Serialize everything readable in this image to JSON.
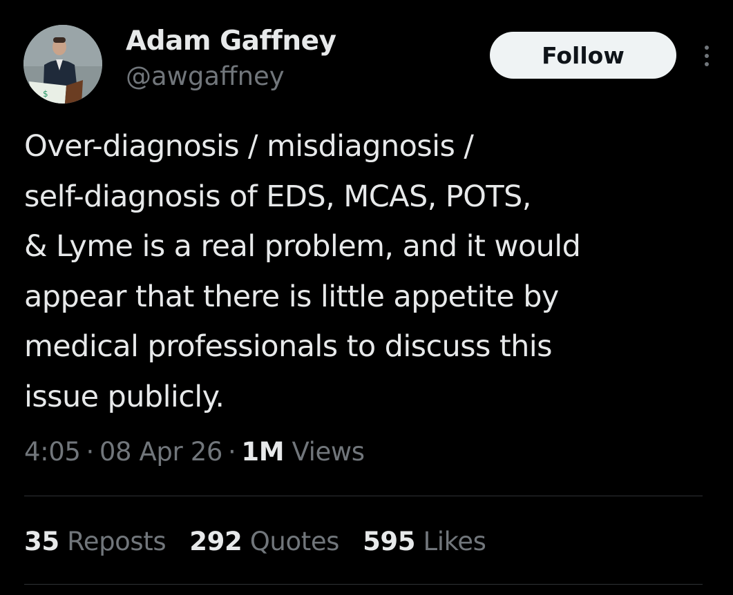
{
  "author": {
    "display_name": "Adam Gaffney",
    "handle": "@awgaffney"
  },
  "actions": {
    "follow_label": "Follow"
  },
  "tweet": {
    "text_lines": [
      "Over-diagnosis / misdiagnosis /",
      "self-diagnosis of EDS, MCAS, POTS,",
      "& Lyme is a real problem, and it would",
      "appear that there is little appetite by",
      "medical professionals to discuss this",
      "issue publicly."
    ],
    "time": "4:05",
    "date": "08 Apr 26",
    "separator": "·",
    "views_count": "1M",
    "views_label": "Views"
  },
  "stats": {
    "reposts_count": "35",
    "reposts_label": "Reposts",
    "quotes_count": "292",
    "quotes_label": "Quotes",
    "likes_count": "595",
    "likes_label": "Likes"
  },
  "icons": {
    "more": "more-horizontal-icon",
    "avatar": "avatar-photo"
  },
  "colors": {
    "background": "#000000",
    "primary_text": "#e7e9ea",
    "secondary_text": "#71767b",
    "follow_bg": "#eff3f4",
    "follow_text": "#0f1419",
    "divider": "#2f3336"
  }
}
